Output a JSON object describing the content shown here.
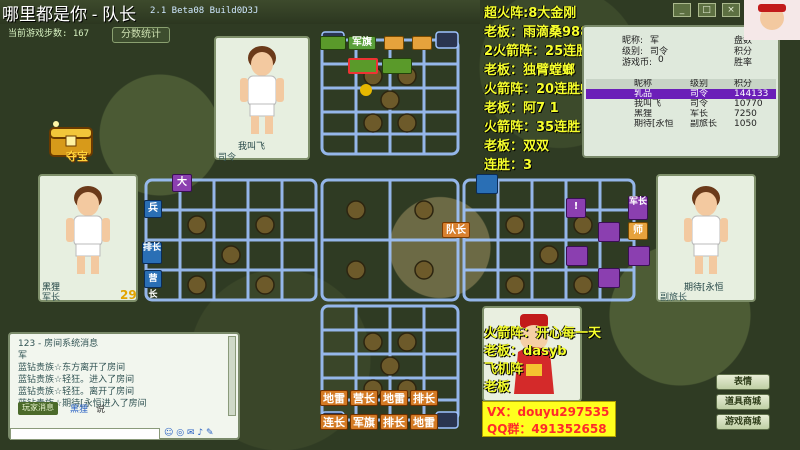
{
  "window": {
    "title": "哪里都是你 - 队长",
    "version": "2.1 Beta08 Build0D3J",
    "step_count": "当前游戏步数: 167",
    "stats_button": "分数统计",
    "minimize": "_",
    "restore": "□",
    "close": "×"
  },
  "treasure": {
    "label": "夺宝"
  },
  "players": {
    "top": {
      "name": "我叫飞",
      "rank": "司令"
    },
    "left": {
      "name": "黑狸",
      "rank": "军长",
      "level": "29"
    },
    "right": {
      "name": "期待[永恒",
      "rank": "副旅长"
    }
  },
  "board_pieces": {
    "top_green": [
      "军旗",
      "",
      ""
    ],
    "left_col": [
      "大",
      "兵",
      "排长",
      "营长"
    ],
    "right_col": [
      "!",
      "军长",
      "师"
    ],
    "center": "队长",
    "bottom_row1": [
      "地雷",
      "营长",
      "地雷",
      "排长"
    ],
    "bottom_row2": [
      "连长",
      "军旗",
      "排长",
      "地雷"
    ]
  },
  "room": {
    "nickname_label": "昵称:",
    "nickname_value": "军",
    "level_label": "级别:",
    "level_value": "司令",
    "coins_label": "游戏币:",
    "coins_value": "0",
    "right_labels": [
      "盘数",
      "积分",
      "胜率"
    ],
    "headers": [
      "昵称",
      "级别",
      "积分"
    ],
    "rows": [
      {
        "name": "乳品",
        "rank": "司令",
        "score": "144133",
        "selected": true
      },
      {
        "name": "我叫飞",
        "rank": "司令",
        "score": "10770",
        "selected": false
      },
      {
        "name": "黑狸",
        "rank": "军长",
        "score": "7250",
        "selected": false
      },
      {
        "name": "期待[永恒",
        "rank": "副旅长",
        "score": "1050",
        "selected": false
      }
    ]
  },
  "overlay_left": [
    "超火阵:8大金刚",
    "老板：雨滴桑988",
    "2火箭阵：25连胜2次",
    "老板：独臂螳螂",
    "火箭阵：20连胜蜂巢刀塔",
    "老板：阿7 1",
    "火箭阵：35连胜",
    "老板：双双",
    "连胜：3"
  ],
  "overlay_bottom": [
    "火箭阵：开心每一天",
    "老板：dasyb",
    "飞机阵",
    "老板"
  ],
  "promo": {
    "vx": "VX：douyu297535",
    "qq": "QQ群：491352658"
  },
  "chat": {
    "lines": [
      "123 - 房间系统消息",
      "军",
      "蓝钻贵族☆东方离开了房间",
      "蓝钻贵族☆轻狂。进入了房间",
      "蓝钻贵族☆轻狂。离开了房间",
      "蓝钻贵族☆期待[永恒进入了房间"
    ],
    "send_button": "玩家消息",
    "input_label": "黑狸",
    "say_label": "说"
  },
  "side_buttons": [
    "表情",
    "道具商城",
    "游戏商城"
  ],
  "colors": {
    "overlay_text": "#f6ff2c",
    "promo_bg": "#ffff1e",
    "promo_text": "#ff2a2a",
    "room_selected": "#6b1fb8"
  }
}
